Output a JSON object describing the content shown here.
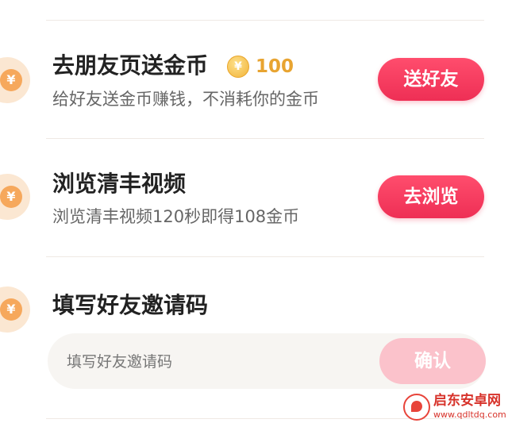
{
  "tasks": [
    {
      "title": "去朋友页送金币",
      "desc": "给好友送金币赚钱，不消耗你的金币",
      "reward": "100",
      "button": "送好友",
      "badge_icon": "yen-coin-icon"
    },
    {
      "title": "浏览清丰视频",
      "desc": "浏览清丰视频120秒即得108金币",
      "button": "去浏览",
      "badge_icon": "yen-coin-icon"
    },
    {
      "title": "填写好友邀请码",
      "badge_icon": "yen-coin-icon"
    }
  ],
  "invite": {
    "placeholder": "填写好友邀请码",
    "confirm": "确认"
  },
  "coin_symbol": "¥",
  "watermark": {
    "title": "启东安卓网",
    "url": "www.qdltdq.com"
  },
  "colors": {
    "primary_button": "#ee2f55",
    "disabled_button": "#fbc2cb",
    "coin_gold": "#e8a431",
    "badge_bg": "#fbe7d2",
    "badge_coin": "#f6a85c",
    "title_text": "#222222",
    "desc_text": "#666666"
  }
}
